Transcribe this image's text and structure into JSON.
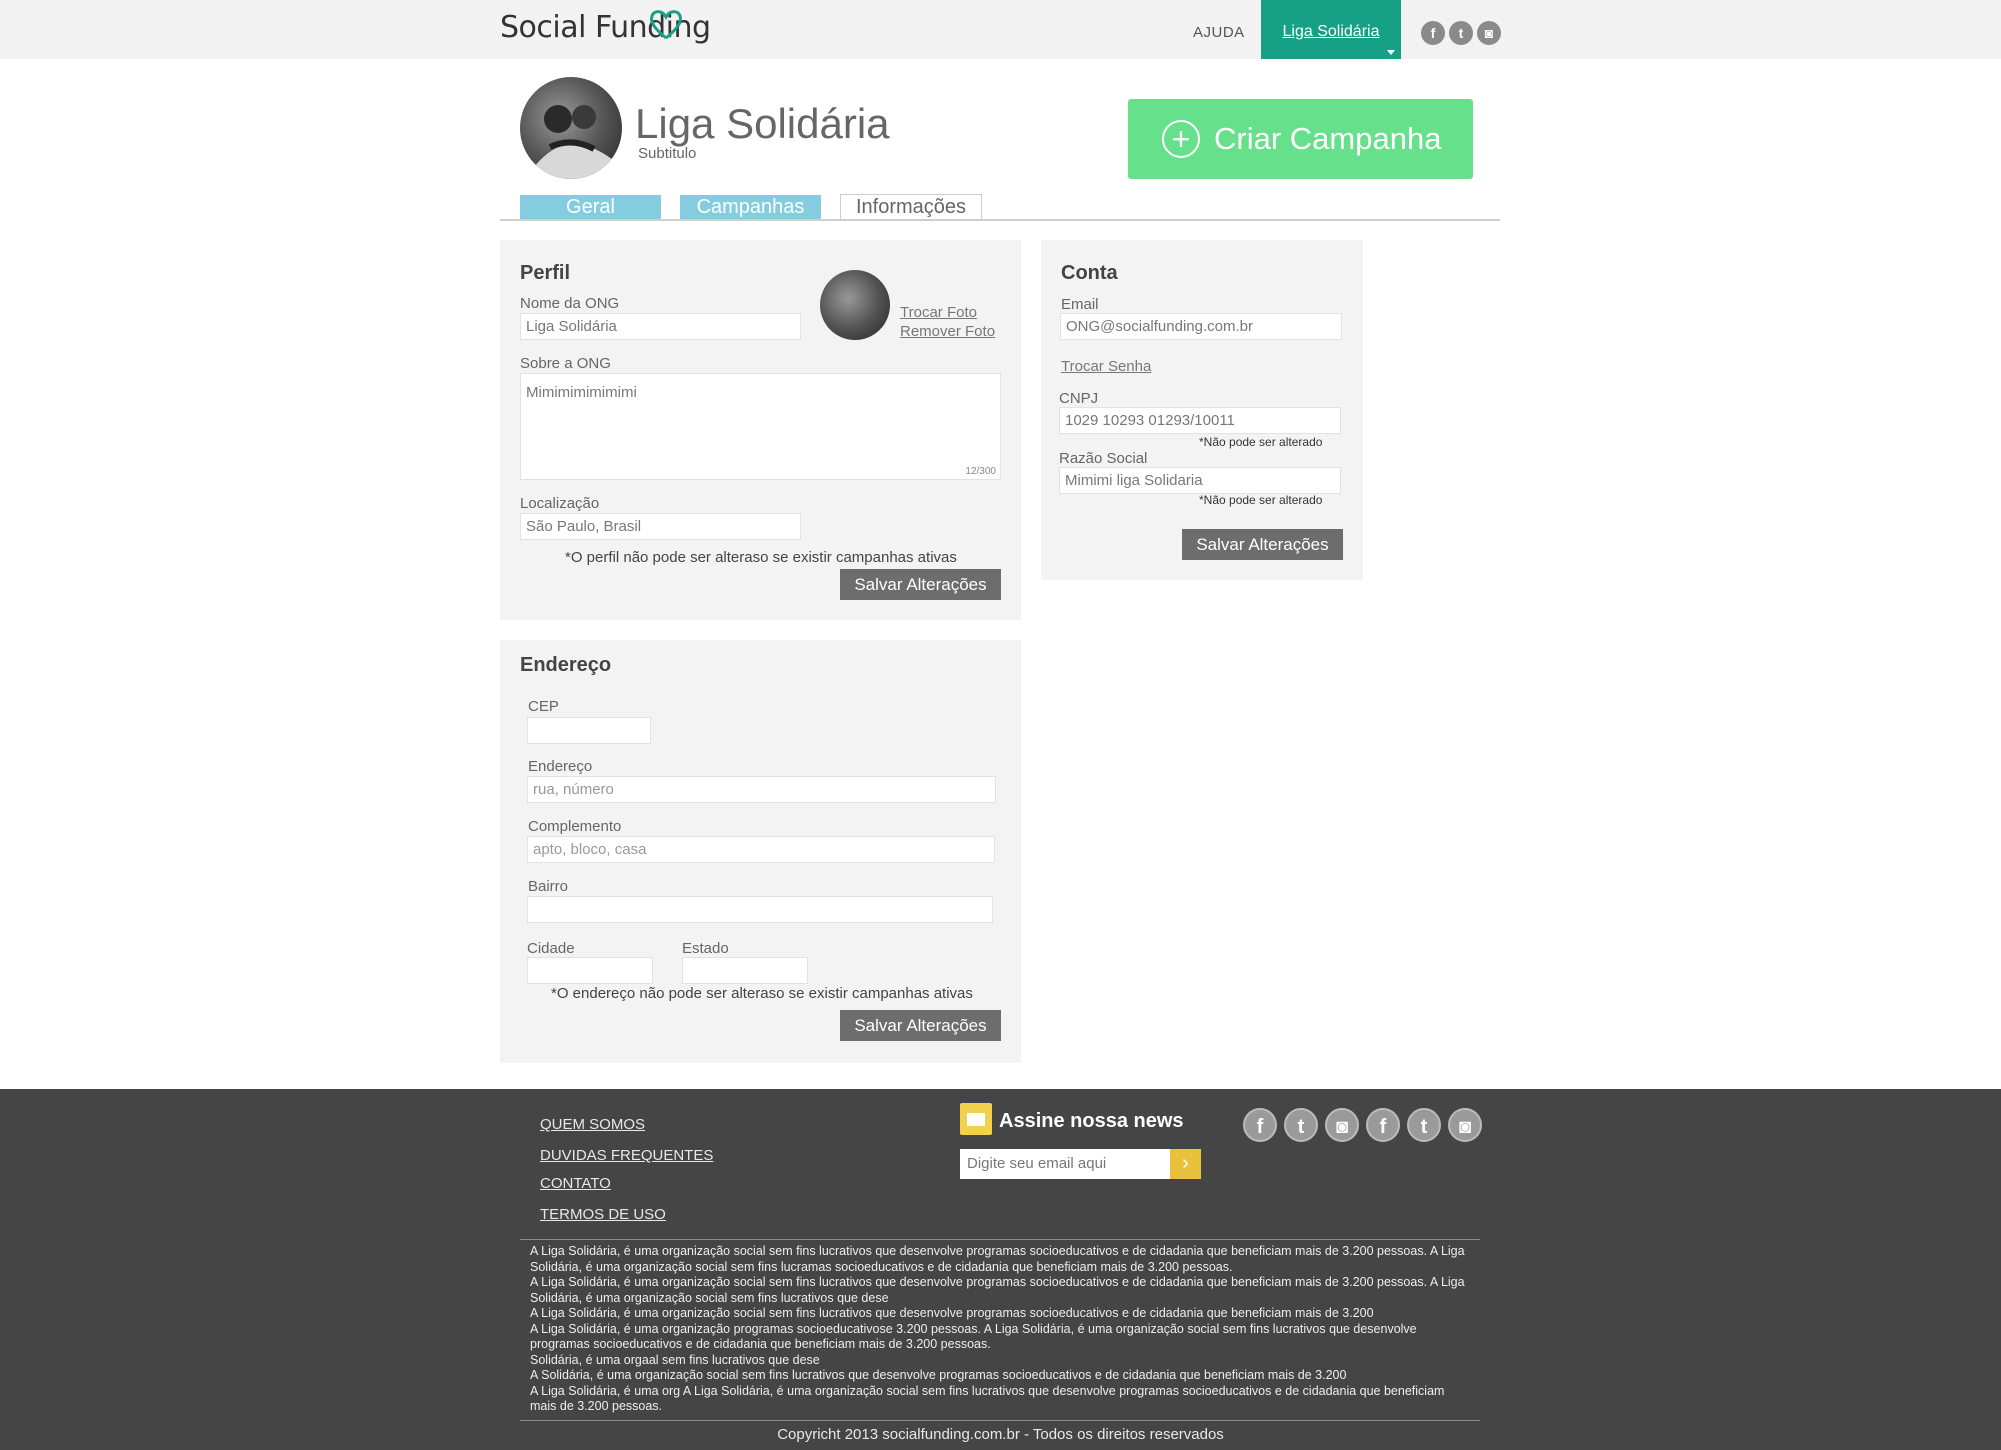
{
  "header": {
    "logo_text": "Social Funding",
    "nav_help": "AJUDA",
    "nav_account": "Liga Solidária",
    "social_icons": [
      "facebook-icon",
      "twitter-icon",
      "instagram-icon"
    ]
  },
  "profile": {
    "name": "Liga Solidária",
    "subtitle": "Subtitulo",
    "create_button": "Criar Campanha"
  },
  "tabs": [
    {
      "label": "Geral",
      "active": false
    },
    {
      "label": "Campanhas",
      "active": false
    },
    {
      "label": "Informações",
      "active": true
    }
  ],
  "perfil": {
    "title": "Perfil",
    "name_label": "Nome da ONG",
    "name_value": "Liga Solidária",
    "change_photo": "Trocar Foto",
    "remove_photo": "Remover Foto",
    "about_label": "Sobre a ONG",
    "about_value": "Mimimimimimimi",
    "about_counter": "12/300",
    "location_label": "Localização",
    "location_value": "São Paulo, Brasil",
    "note": "*O perfil não pode ser alteraso se existir campanhas ativas",
    "save": "Salvar Alterações"
  },
  "conta": {
    "title": "Conta",
    "email_label": "Email",
    "email_value": "ONG@socialfunding.com.br",
    "change_password": "Trocar Senha",
    "cnpj_label": "CNPJ",
    "cnpj_value": "1029 10293 01293/10011",
    "cnpj_note": "*Não pode ser alterado",
    "razao_label": "Razão Social",
    "razao_value": "Mimimi liga Solidaria",
    "razao_note": "*Não pode ser alterado",
    "save": "Salvar Alterações"
  },
  "endereco": {
    "title": "Endereço",
    "cep_label": "CEP",
    "address_label": "Endereço",
    "address_placeholder": "rua, número",
    "complement_label": "Complemento",
    "complement_placeholder": "apto, bloco, casa",
    "bairro_label": "Bairro",
    "city_label": "Cidade",
    "state_label": "Estado",
    "note": "*O endereço não pode ser alteraso se existir campanhas ativas",
    "save": "Salvar Alterações"
  },
  "footer": {
    "links": [
      "QUEM SOMOS",
      "DUVIDAS FREQUENTES",
      "CONTATO",
      "TERMOS DE USO"
    ],
    "newsletter_title": "Assine nossa news",
    "newsletter_placeholder": "Digite seu email aqui",
    "newsletter_button": "›",
    "social_icons": [
      "facebook-icon",
      "twitter-icon",
      "instagram-icon",
      "facebook-icon",
      "twitter-icon",
      "instagram-icon"
    ],
    "about_lines": [
      "A Liga Solidária, é uma organização social sem fins lucrativos que desenvolve programas socioeducativos e de cidadania que beneficiam mais de 3.200 pessoas. A Liga Solidária, é uma organização social sem fins lucramas socioeducativos e de cidadania que beneficiam mais de 3.200 pessoas.",
      "A Liga Solidária, é uma organização social sem fins lucrativos que desenvolve programas socioeducativos e de cidadania que beneficiam mais de 3.200 pessoas. A Liga Solidária, é uma organização social sem fins lucrativos que dese",
      "A Liga Solidária, é uma organização social sem fins lucrativos que desenvolve programas socioeducativos e de cidadania que beneficiam mais de 3.200",
      "A Liga Solidária, é uma organização  programas socioeducativose 3.200 pessoas. A Liga Solidária, é uma organização social sem fins lucrativos que desenvolve programas socioeducativos e de cidadania que beneficiam mais de 3.200 pessoas.",
      "Solidária, é uma orgaal sem fins lucrativos que dese",
      "A Solidária, é uma organização social sem fins lucrativos que desenvolve programas socioeducativos e de cidadania que beneficiam mais de 3.200",
      "A Liga Solidária, é uma org A Liga Solidária, é uma organização social sem fins lucrativos que desenvolve programas socioeducativos e de cidadania que beneficiam mais de 3.200 pessoas."
    ],
    "copyright": "Copyricht 2013 socialfunding.com.br - Todos os direitos reservados"
  }
}
